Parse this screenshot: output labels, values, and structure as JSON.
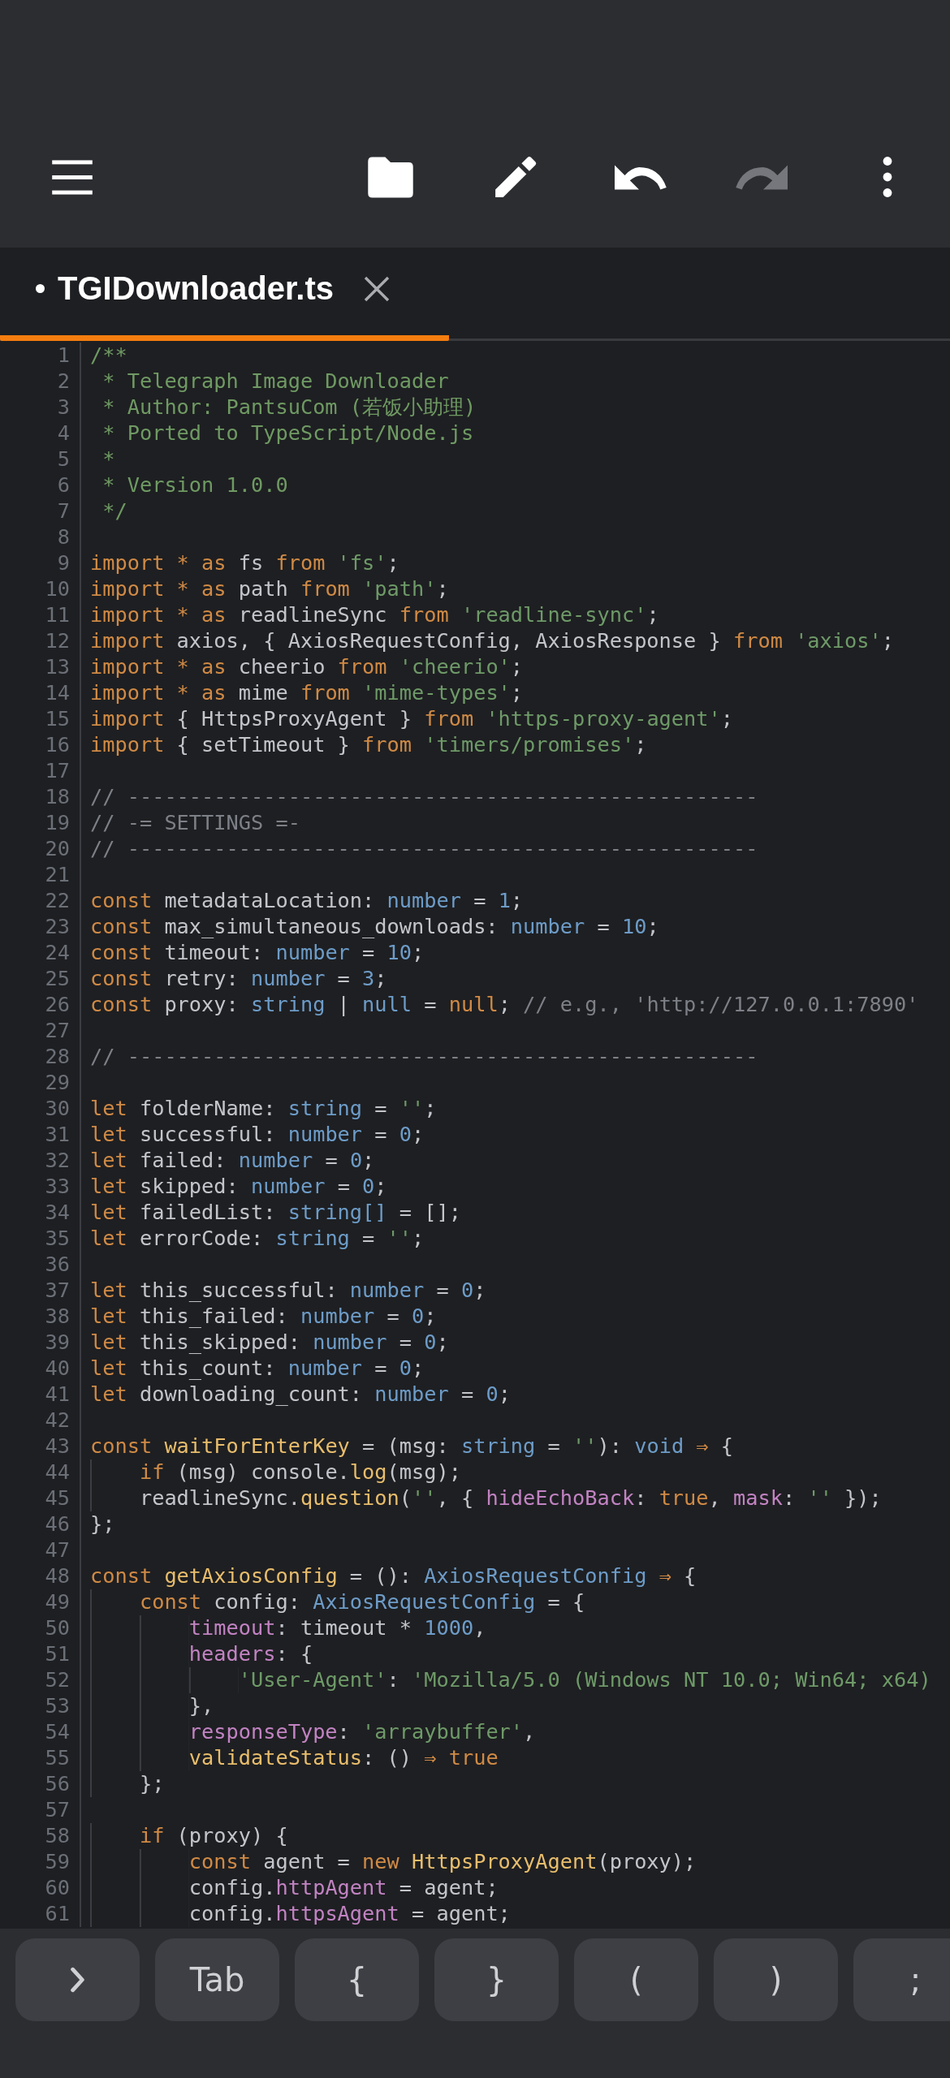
{
  "toolbar": {
    "buttons": [
      {
        "kind": "menu",
        "disabled": false
      },
      {
        "kind": "folder",
        "disabled": false
      },
      {
        "kind": "pencil",
        "disabled": false
      },
      {
        "kind": "undo",
        "disabled": false
      },
      {
        "kind": "redo",
        "disabled": true
      },
      {
        "kind": "more",
        "disabled": false
      }
    ]
  },
  "tabs": [
    {
      "label": "TGIDownloader.ts",
      "modified": true,
      "selected": true
    }
  ],
  "editor": {
    "lines": [
      {
        "number": "1",
        "tokens": [
          {
            "kind": "doc",
            "text": "/**"
          }
        ]
      },
      {
        "number": "2",
        "tokens": [
          {
            "kind": "doc",
            "text": " * Telegraph Image Downloader"
          }
        ]
      },
      {
        "number": "3",
        "tokens": [
          {
            "kind": "doc",
            "text": " * Author: PantsuCom (若饭小助理)"
          }
        ]
      },
      {
        "number": "4",
        "tokens": [
          {
            "kind": "doc",
            "text": " * Ported to TypeScript/Node.js"
          }
        ]
      },
      {
        "number": "5",
        "tokens": [
          {
            "kind": "doc",
            "text": " *"
          }
        ]
      },
      {
        "number": "6",
        "tokens": [
          {
            "kind": "doc",
            "text": " * Version 1.0.0"
          }
        ]
      },
      {
        "number": "7",
        "tokens": [
          {
            "kind": "doc",
            "text": " */"
          }
        ]
      },
      {
        "number": "8"
      },
      {
        "number": "9",
        "tokens": [
          {
            "kind": "keyword",
            "text": "import * as"
          },
          {
            "kind": "plain",
            "text": " fs "
          },
          {
            "kind": "keyword",
            "text": "from "
          },
          {
            "kind": "string",
            "text": "'fs'"
          },
          {
            "kind": "plain",
            "text": ";"
          }
        ]
      },
      {
        "number": "10",
        "tokens": [
          {
            "kind": "keyword",
            "text": "import * as"
          },
          {
            "kind": "plain",
            "text": " path "
          },
          {
            "kind": "keyword",
            "text": "from "
          },
          {
            "kind": "string",
            "text": "'path'"
          },
          {
            "kind": "plain",
            "text": ";"
          }
        ]
      },
      {
        "number": "11",
        "tokens": [
          {
            "kind": "keyword",
            "text": "import * as"
          },
          {
            "kind": "plain",
            "text": " readlineSync "
          },
          {
            "kind": "keyword",
            "text": "from "
          },
          {
            "kind": "string",
            "text": "'readline-sync'"
          },
          {
            "kind": "plain",
            "text": ";"
          }
        ]
      },
      {
        "number": "12",
        "tokens": [
          {
            "kind": "keyword",
            "text": "import"
          },
          {
            "kind": "plain",
            "text": " axios, { AxiosRequestConfig, AxiosResponse } "
          },
          {
            "kind": "keyword",
            "text": "from "
          },
          {
            "kind": "string",
            "text": "'axios'"
          },
          {
            "kind": "plain",
            "text": ";"
          }
        ]
      },
      {
        "number": "13",
        "tokens": [
          {
            "kind": "keyword",
            "text": "import * as"
          },
          {
            "kind": "plain",
            "text": " cheerio "
          },
          {
            "kind": "keyword",
            "text": "from "
          },
          {
            "kind": "string",
            "text": "'cheerio'"
          },
          {
            "kind": "plain",
            "text": ";"
          }
        ]
      },
      {
        "number": "14",
        "tokens": [
          {
            "kind": "keyword",
            "text": "import * as"
          },
          {
            "kind": "plain",
            "text": " mime "
          },
          {
            "kind": "keyword",
            "text": "from "
          },
          {
            "kind": "string",
            "text": "'mime-types'"
          },
          {
            "kind": "plain",
            "text": ";"
          }
        ]
      },
      {
        "number": "15",
        "tokens": [
          {
            "kind": "keyword",
            "text": "import"
          },
          {
            "kind": "plain",
            "text": " { HttpsProxyAgent } "
          },
          {
            "kind": "keyword",
            "text": "from "
          },
          {
            "kind": "string",
            "text": "'https-proxy-agent'"
          },
          {
            "kind": "plain",
            "text": ";"
          }
        ]
      },
      {
        "number": "16",
        "tokens": [
          {
            "kind": "keyword",
            "text": "import"
          },
          {
            "kind": "plain",
            "text": " { setTimeout } "
          },
          {
            "kind": "keyword",
            "text": "from "
          },
          {
            "kind": "string",
            "text": "'timers/promises'"
          },
          {
            "kind": "plain",
            "text": ";"
          }
        ]
      },
      {
        "number": "17"
      },
      {
        "number": "18",
        "tokens": [
          {
            "kind": "comment",
            "text": "// ---------------------------------------------------"
          }
        ]
      },
      {
        "number": "19",
        "tokens": [
          {
            "kind": "comment",
            "text": "// -= SETTINGS =-"
          }
        ]
      },
      {
        "number": "20",
        "tokens": [
          {
            "kind": "comment",
            "text": "// ---------------------------------------------------"
          }
        ]
      },
      {
        "number": "21"
      },
      {
        "number": "22",
        "tokens": [
          {
            "kind": "keyword",
            "text": "const"
          },
          {
            "kind": "plain",
            "text": " metadataLocation: "
          },
          {
            "kind": "type",
            "text": "number"
          },
          {
            "kind": "plain",
            "text": " = "
          },
          {
            "kind": "type",
            "text": "1"
          },
          {
            "kind": "plain",
            "text": ";"
          }
        ]
      },
      {
        "number": "23",
        "tokens": [
          {
            "kind": "keyword",
            "text": "const"
          },
          {
            "kind": "plain",
            "text": " max_simultaneous_downloads: "
          },
          {
            "kind": "type",
            "text": "number"
          },
          {
            "kind": "plain",
            "text": " = "
          },
          {
            "kind": "type",
            "text": "10"
          },
          {
            "kind": "plain",
            "text": ";"
          }
        ]
      },
      {
        "number": "24",
        "tokens": [
          {
            "kind": "keyword",
            "text": "const"
          },
          {
            "kind": "plain",
            "text": " timeout: "
          },
          {
            "kind": "type",
            "text": "number"
          },
          {
            "kind": "plain",
            "text": " = "
          },
          {
            "kind": "type",
            "text": "10"
          },
          {
            "kind": "plain",
            "text": ";"
          }
        ]
      },
      {
        "number": "25",
        "tokens": [
          {
            "kind": "keyword",
            "text": "const"
          },
          {
            "kind": "plain",
            "text": " retry: "
          },
          {
            "kind": "type",
            "text": "number"
          },
          {
            "kind": "plain",
            "text": " = "
          },
          {
            "kind": "type",
            "text": "3"
          },
          {
            "kind": "plain",
            "text": ";"
          }
        ]
      },
      {
        "number": "26",
        "tokens": [
          {
            "kind": "keyword",
            "text": "const"
          },
          {
            "kind": "plain",
            "text": " proxy: "
          },
          {
            "kind": "type",
            "text": "string"
          },
          {
            "kind": "plain",
            "text": " | "
          },
          {
            "kind": "type",
            "text": "null"
          },
          {
            "kind": "plain",
            "text": " = "
          },
          {
            "kind": "keyword",
            "text": "null"
          },
          {
            "kind": "plain",
            "text": "; "
          },
          {
            "kind": "comment",
            "text": "// e.g., 'http://127.0.0.1:7890'"
          }
        ]
      },
      {
        "number": "27"
      },
      {
        "number": "28",
        "tokens": [
          {
            "kind": "comment",
            "text": "// ---------------------------------------------------"
          }
        ]
      },
      {
        "number": "29"
      },
      {
        "number": "30",
        "tokens": [
          {
            "kind": "keyword",
            "text": "let"
          },
          {
            "kind": "plain",
            "text": " folderName: "
          },
          {
            "kind": "type",
            "text": "string"
          },
          {
            "kind": "plain",
            "text": " = "
          },
          {
            "kind": "string",
            "text": "''"
          },
          {
            "kind": "plain",
            "text": ";"
          }
        ]
      },
      {
        "number": "31",
        "tokens": [
          {
            "kind": "keyword",
            "text": "let"
          },
          {
            "kind": "plain",
            "text": " successful: "
          },
          {
            "kind": "type",
            "text": "number"
          },
          {
            "kind": "plain",
            "text": " = "
          },
          {
            "kind": "type",
            "text": "0"
          },
          {
            "kind": "plain",
            "text": ";"
          }
        ]
      },
      {
        "number": "32",
        "tokens": [
          {
            "kind": "keyword",
            "text": "let"
          },
          {
            "kind": "plain",
            "text": " failed: "
          },
          {
            "kind": "type",
            "text": "number"
          },
          {
            "kind": "plain",
            "text": " = "
          },
          {
            "kind": "type",
            "text": "0"
          },
          {
            "kind": "plain",
            "text": ";"
          }
        ]
      },
      {
        "number": "33",
        "tokens": [
          {
            "kind": "keyword",
            "text": "let"
          },
          {
            "kind": "plain",
            "text": " skipped: "
          },
          {
            "kind": "type",
            "text": "number"
          },
          {
            "kind": "plain",
            "text": " = "
          },
          {
            "kind": "type",
            "text": "0"
          },
          {
            "kind": "plain",
            "text": ";"
          }
        ]
      },
      {
        "number": "34",
        "tokens": [
          {
            "kind": "keyword",
            "text": "let"
          },
          {
            "kind": "plain",
            "text": " failedList: "
          },
          {
            "kind": "type",
            "text": "string[]"
          },
          {
            "kind": "plain",
            "text": " = [];"
          }
        ]
      },
      {
        "number": "35",
        "tokens": [
          {
            "kind": "keyword",
            "text": "let"
          },
          {
            "kind": "plain",
            "text": " errorCode: "
          },
          {
            "kind": "type",
            "text": "string"
          },
          {
            "kind": "plain",
            "text": " = "
          },
          {
            "kind": "string",
            "text": "''"
          },
          {
            "kind": "plain",
            "text": ";"
          }
        ]
      },
      {
        "number": "36"
      },
      {
        "number": "37",
        "tokens": [
          {
            "kind": "keyword",
            "text": "let"
          },
          {
            "kind": "plain",
            "text": " this_successful: "
          },
          {
            "kind": "type",
            "text": "number"
          },
          {
            "kind": "plain",
            "text": " = "
          },
          {
            "kind": "type",
            "text": "0"
          },
          {
            "kind": "plain",
            "text": ";"
          }
        ]
      },
      {
        "number": "38",
        "tokens": [
          {
            "kind": "keyword",
            "text": "let"
          },
          {
            "kind": "plain",
            "text": " this_failed: "
          },
          {
            "kind": "type",
            "text": "number"
          },
          {
            "kind": "plain",
            "text": " = "
          },
          {
            "kind": "type",
            "text": "0"
          },
          {
            "kind": "plain",
            "text": ";"
          }
        ]
      },
      {
        "number": "39",
        "tokens": [
          {
            "kind": "keyword",
            "text": "let"
          },
          {
            "kind": "plain",
            "text": " this_skipped: "
          },
          {
            "kind": "type",
            "text": "number"
          },
          {
            "kind": "plain",
            "text": " = "
          },
          {
            "kind": "type",
            "text": "0"
          },
          {
            "kind": "plain",
            "text": ";"
          }
        ]
      },
      {
        "number": "40",
        "tokens": [
          {
            "kind": "keyword",
            "text": "let"
          },
          {
            "kind": "plain",
            "text": " this_count: "
          },
          {
            "kind": "type",
            "text": "number"
          },
          {
            "kind": "plain",
            "text": " = "
          },
          {
            "kind": "type",
            "text": "0"
          },
          {
            "kind": "plain",
            "text": ";"
          }
        ]
      },
      {
        "number": "41",
        "tokens": [
          {
            "kind": "keyword",
            "text": "let"
          },
          {
            "kind": "plain",
            "text": " downloading_count: "
          },
          {
            "kind": "type",
            "text": "number"
          },
          {
            "kind": "plain",
            "text": " = "
          },
          {
            "kind": "type",
            "text": "0"
          },
          {
            "kind": "plain",
            "text": ";"
          }
        ]
      },
      {
        "number": "42"
      },
      {
        "number": "43",
        "tokens": [
          {
            "kind": "keyword",
            "text": "const "
          },
          {
            "kind": "function",
            "text": "waitForEnterKey"
          },
          {
            "kind": "plain",
            "text": " = (msg: "
          },
          {
            "kind": "type",
            "text": "string"
          },
          {
            "kind": "plain",
            "text": " = "
          },
          {
            "kind": "string",
            "text": "''"
          },
          {
            "kind": "plain",
            "text": "): "
          },
          {
            "kind": "type",
            "text": "void "
          },
          {
            "kind": "keyword",
            "text": "⇒"
          },
          {
            "kind": "plain",
            "text": " {"
          }
        ]
      },
      {
        "number": "44",
        "tokens": [
          {
            "kind": "keyword",
            "text": "    if"
          },
          {
            "kind": "plain",
            "text": " (msg) console."
          },
          {
            "kind": "function",
            "text": "log"
          },
          {
            "kind": "plain",
            "text": "(msg);"
          }
        ]
      },
      {
        "number": "45",
        "tokens": [
          {
            "kind": "plain",
            "text": "    readlineSync."
          },
          {
            "kind": "function",
            "text": "question"
          },
          {
            "kind": "plain",
            "text": "("
          },
          {
            "kind": "string",
            "text": "''"
          },
          {
            "kind": "plain",
            "text": ", { "
          },
          {
            "kind": "property",
            "text": "hideEchoBack"
          },
          {
            "kind": "plain",
            "text": ": "
          },
          {
            "kind": "keyword",
            "text": "true"
          },
          {
            "kind": "plain",
            "text": ", "
          },
          {
            "kind": "property",
            "text": "mask"
          },
          {
            "kind": "plain",
            "text": ": "
          },
          {
            "kind": "string",
            "text": "''"
          },
          {
            "kind": "plain",
            "text": " });"
          }
        ]
      },
      {
        "number": "46",
        "tokens": [
          {
            "kind": "plain",
            "text": "};"
          }
        ]
      },
      {
        "number": "47"
      },
      {
        "number": "48",
        "tokens": [
          {
            "kind": "keyword",
            "text": "const "
          },
          {
            "kind": "function",
            "text": "getAxiosConfig"
          },
          {
            "kind": "plain",
            "text": " = (): "
          },
          {
            "kind": "type",
            "text": "AxiosRequestConfig "
          },
          {
            "kind": "keyword",
            "text": "⇒"
          },
          {
            "kind": "plain",
            "text": " {"
          }
        ]
      },
      {
        "number": "49",
        "tokens": [
          {
            "kind": "keyword",
            "text": "    const"
          },
          {
            "kind": "plain",
            "text": " config: "
          },
          {
            "kind": "type",
            "text": "AxiosRequestConfig"
          },
          {
            "kind": "plain",
            "text": " = {"
          }
        ]
      },
      {
        "number": "50",
        "tokens": [
          {
            "kind": "property",
            "text": "        timeout"
          },
          {
            "kind": "plain",
            "text": ": timeout * "
          },
          {
            "kind": "type",
            "text": "1000"
          },
          {
            "kind": "plain",
            "text": ","
          }
        ]
      },
      {
        "number": "51",
        "tokens": [
          {
            "kind": "property",
            "text": "        headers"
          },
          {
            "kind": "plain",
            "text": ": {"
          }
        ]
      },
      {
        "number": "52",
        "tokens": [
          {
            "kind": "string",
            "text": "            'User-Agent'"
          },
          {
            "kind": "plain",
            "text": ": "
          },
          {
            "kind": "string",
            "text": "'Mozilla/5.0 (Windows NT 10.0; Win64; x64)"
          }
        ]
      },
      {
        "number": "53",
        "tokens": [
          {
            "kind": "plain",
            "text": "        },"
          }
        ]
      },
      {
        "number": "54",
        "tokens": [
          {
            "kind": "property",
            "text": "        responseType"
          },
          {
            "kind": "plain",
            "text": ": "
          },
          {
            "kind": "string",
            "text": "'arraybuffer'"
          },
          {
            "kind": "plain",
            "text": ","
          }
        ]
      },
      {
        "number": "55",
        "tokens": [
          {
            "kind": "function",
            "text": "        validateStatus"
          },
          {
            "kind": "plain",
            "text": ": () "
          },
          {
            "kind": "keyword",
            "text": "⇒ true"
          }
        ]
      },
      {
        "number": "56",
        "tokens": [
          {
            "kind": "plain",
            "text": "    };"
          }
        ]
      },
      {
        "number": "57"
      },
      {
        "number": "58",
        "tokens": [
          {
            "kind": "keyword",
            "text": "    if"
          },
          {
            "kind": "plain",
            "text": " (proxy) {"
          }
        ]
      },
      {
        "number": "59",
        "tokens": [
          {
            "kind": "keyword",
            "text": "        const"
          },
          {
            "kind": "plain",
            "text": " agent = "
          },
          {
            "kind": "keyword",
            "text": "new "
          },
          {
            "kind": "function",
            "text": "HttpsProxyAgent"
          },
          {
            "kind": "plain",
            "text": "(proxy);"
          }
        ]
      },
      {
        "number": "60",
        "tokens": [
          {
            "kind": "plain",
            "text": "        config."
          },
          {
            "kind": "property",
            "text": "httpAgent"
          },
          {
            "kind": "plain",
            "text": " = agent;"
          }
        ]
      },
      {
        "number": "61",
        "tokens": [
          {
            "kind": "plain",
            "text": "        config."
          },
          {
            "kind": "property",
            "text": "httpsAgent"
          },
          {
            "kind": "plain",
            "text": " = agent;"
          }
        ]
      }
    ]
  },
  "key_bar": {
    "keys": [
      {
        "kind": "chevron"
      },
      {
        "kind": "text",
        "label": "Tab"
      },
      {
        "kind": "text",
        "label": "{"
      },
      {
        "kind": "text",
        "label": "}"
      },
      {
        "kind": "text",
        "label": "("
      },
      {
        "kind": "text",
        "label": ")"
      },
      {
        "kind": "text",
        "label": ";"
      }
    ]
  }
}
